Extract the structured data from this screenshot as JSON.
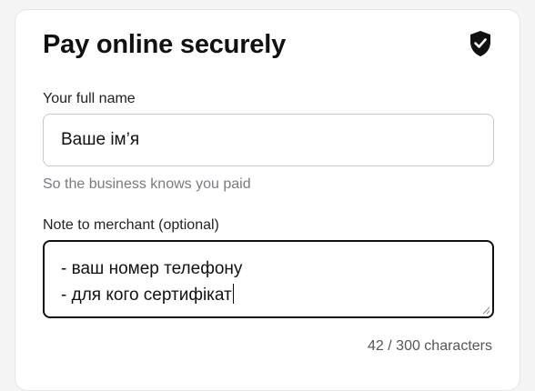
{
  "form": {
    "title": "Pay online securely",
    "security_icon": "shield-check-icon",
    "name_field": {
      "label": "Your full name",
      "value": "Ваше ім’я",
      "hint": "So the business knows you paid"
    },
    "note_field": {
      "label": "Note to merchant (optional)",
      "lines": [
        "- ваш номер телефону",
        "- для кого сертифікат"
      ],
      "counter": "42 / 300 characters"
    }
  },
  "colors": {
    "text": "#111111",
    "muted": "#7a7a80",
    "border": "#c7c7cc",
    "focus_border": "#111111"
  }
}
